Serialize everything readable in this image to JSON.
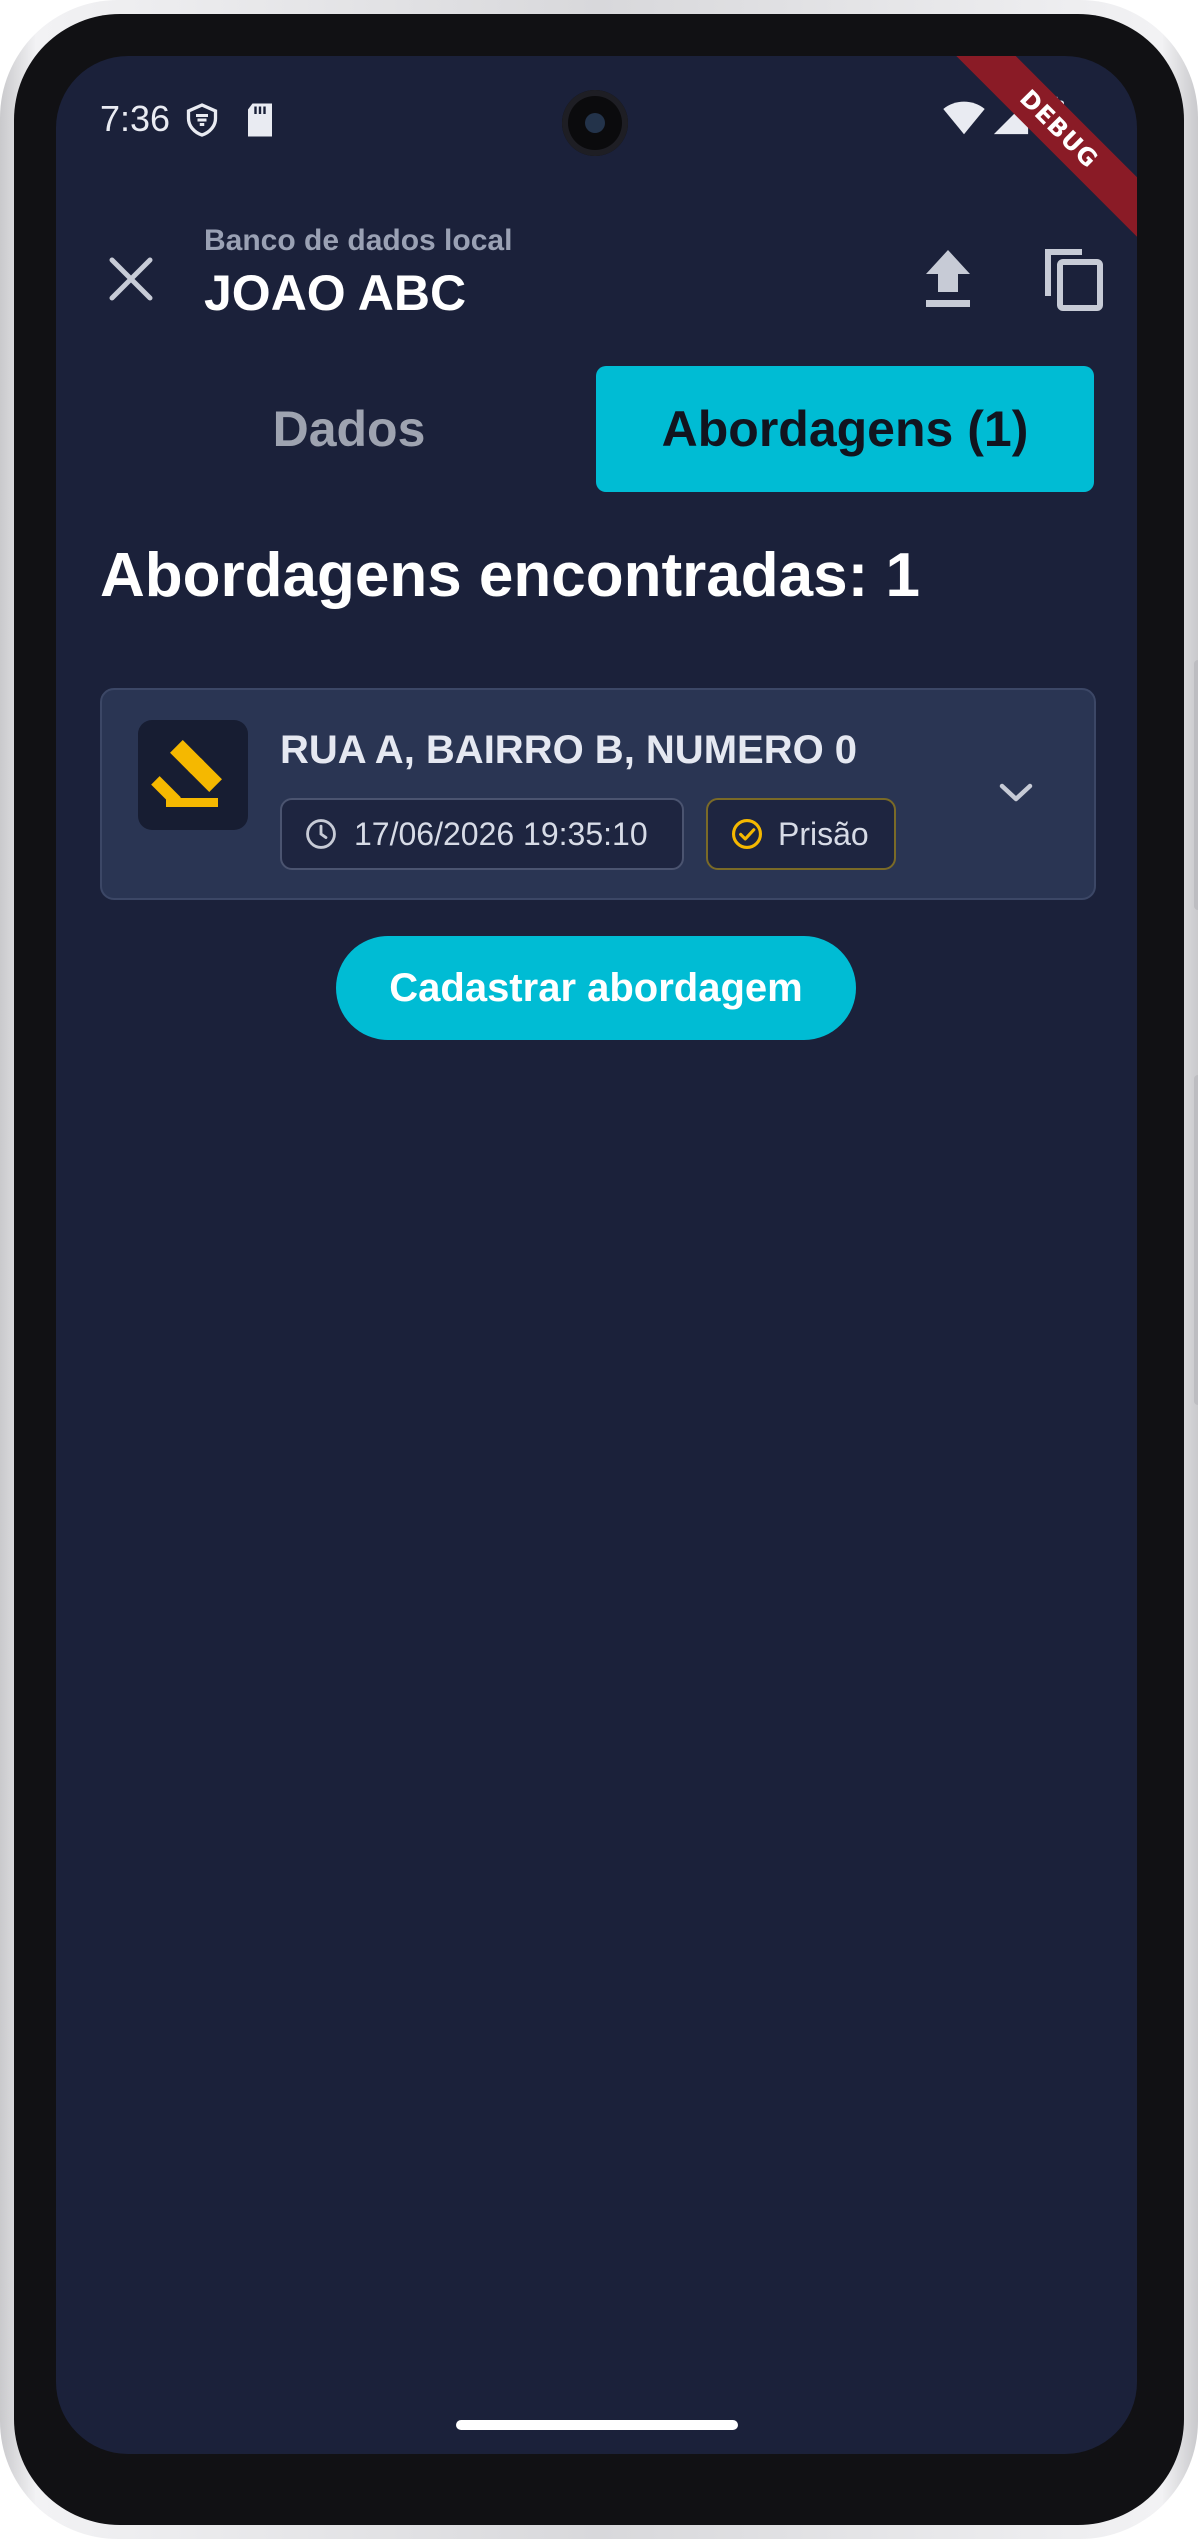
{
  "status_bar": {
    "time": "7:36",
    "icons": [
      "vpn-shield-icon",
      "sd-card-icon",
      "wifi-icon",
      "signal-icon",
      "battery-icon"
    ]
  },
  "debug_banner": "DEBUG",
  "app_bar": {
    "subtitle": "Banco de dados local",
    "title": "JOAO ABC",
    "actions": [
      "upload-icon",
      "copy-icon"
    ]
  },
  "tabs": [
    {
      "label": "Dados",
      "selected": false
    },
    {
      "label": "Abordagens (1)",
      "selected": true
    }
  ],
  "results_heading": "Abordagens encontradas: 1",
  "approaches": [
    {
      "address": "RUA A, BAIRRO B, NUMERO 0",
      "datetime": "17/06/2026 19:35:10",
      "outcome": "Prisão",
      "icon": "gavel-icon"
    }
  ],
  "register_button": "Cadastrar abordagem",
  "colors": {
    "background": "#1b213a",
    "accent": "#00bcd4",
    "card": "#2a3553",
    "gavel": "#f5b800"
  }
}
